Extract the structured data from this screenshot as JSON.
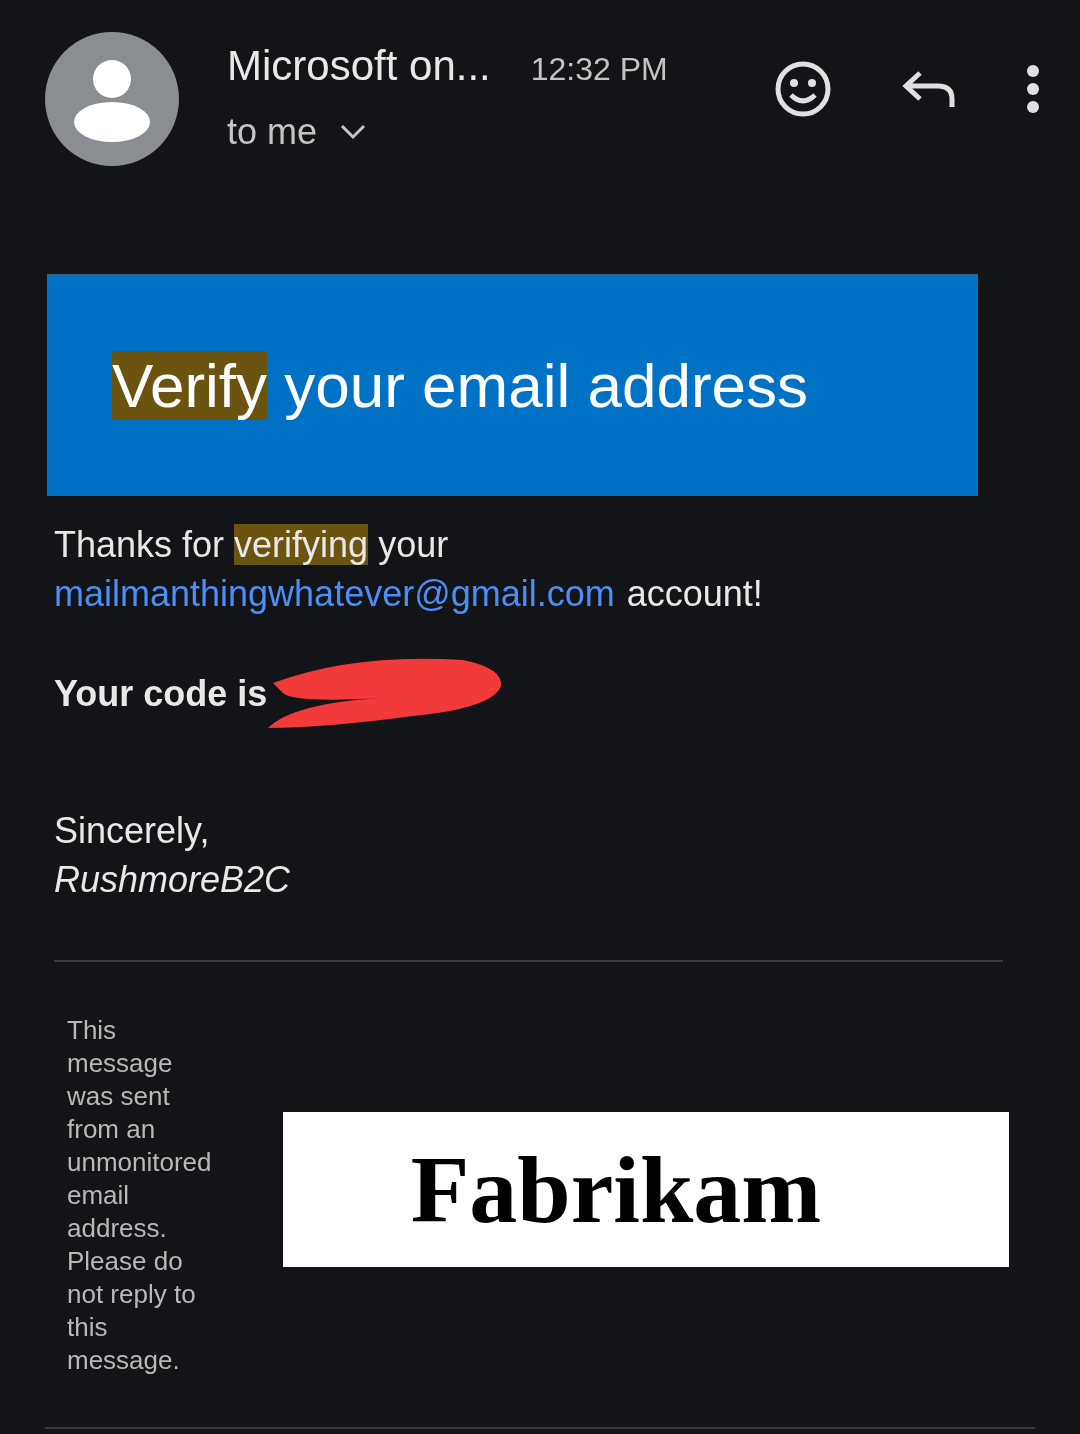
{
  "header": {
    "sender": "Microsoft on...",
    "time": "12:32 PM",
    "recipient": "to me"
  },
  "banner": {
    "heading": [
      {
        "text": "Verify",
        "highlighted": true
      },
      {
        "text": " your email address",
        "highlighted": false
      }
    ]
  },
  "body": {
    "thanks": [
      {
        "text": "Thanks for ",
        "highlighted": false
      },
      {
        "text": "verifying",
        "highlighted": true
      },
      {
        "text": " your",
        "highlighted": false
      }
    ],
    "email_link": "mailmanthingwhatever@gmail.com",
    "account_text": "account!",
    "code_label": "Your code is",
    "signoff": "Sincerely,",
    "signature": "RushmoreB2C"
  },
  "footer": {
    "notice": "This message was sent from an unmonitored email address. Please do not reply to this message.",
    "logo_text": "Fabrikam"
  }
}
